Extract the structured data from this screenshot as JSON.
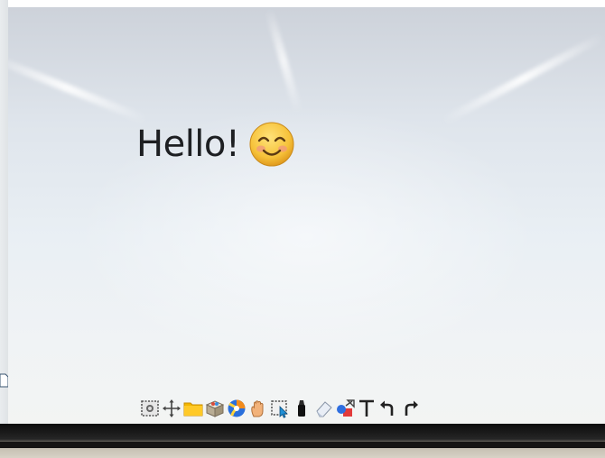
{
  "canvas": {
    "text": "Hello!",
    "emoji": "smiling-face-with-smiling-eyes"
  },
  "toolbar": {
    "tools": [
      {
        "name": "screen-capture",
        "icon": "camera-frame-icon"
      },
      {
        "name": "move",
        "icon": "move-arrows-icon"
      },
      {
        "name": "open-file",
        "icon": "folder-icon"
      },
      {
        "name": "resources",
        "icon": "box-icon"
      },
      {
        "name": "browser",
        "icon": "browser-icon"
      },
      {
        "name": "pan",
        "icon": "hand-icon"
      },
      {
        "name": "select",
        "icon": "select-cursor-icon"
      },
      {
        "name": "pen",
        "icon": "marker-icon"
      },
      {
        "name": "eraser",
        "icon": "eraser-icon"
      },
      {
        "name": "shapes",
        "icon": "shapes-icon"
      },
      {
        "name": "text",
        "icon": "text-icon",
        "glyph": "T"
      },
      {
        "name": "undo",
        "icon": "undo-icon"
      },
      {
        "name": "redo",
        "icon": "redo-icon"
      }
    ]
  },
  "colors": {
    "text": "#1d1f22",
    "folder": "#f2b600",
    "emoji_face": "#f6c23a",
    "bezel": "#151413"
  }
}
